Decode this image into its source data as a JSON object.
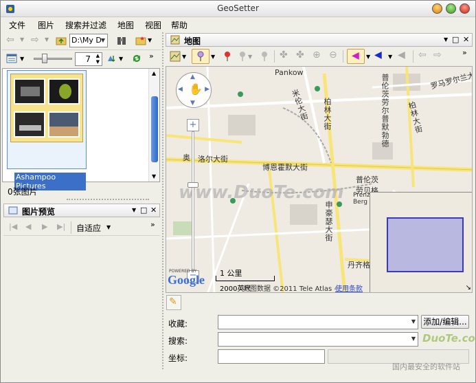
{
  "window": {
    "title": "GeoSetter"
  },
  "menu": [
    "文件",
    "图片",
    "搜索并过滤",
    "地图",
    "视图",
    "帮助"
  ],
  "toolbar": {
    "path_value": "D:\\My D",
    "zoom_value": "7"
  },
  "thumbnail": {
    "label": "Ashampoo Pictures"
  },
  "status": {
    "image_count": "0张图片"
  },
  "preview_panel": {
    "title": "图片预览",
    "fit_label": "自适应"
  },
  "map_panel": {
    "title": "地图"
  },
  "map": {
    "labels": {
      "pankow": "Pankow",
      "street_cn_1": "米伦大街",
      "street_cn_2": "柏林大街",
      "street_cn_3": "普伦茨劳尔普默勃德",
      "street_cn_4": "罗马罗尔兰大",
      "street_cn_5": "柏林大街",
      "street_cn_6": "奥",
      "street_cn_7": "洛尔大街",
      "street_cn_8": "博恩霍默大街",
      "street_cn_9": "普伦茨劳贝格",
      "street_cn_10": "申豪瑟大街",
      "street_cn_11": "丹齐格",
      "street_cn_12": "Prenzl Berg",
      "scale": "1 公里",
      "copyright": "2000英尺",
      "attribution": "地图数据 ©2011 Tele Atlas - ",
      "terms": "使用条款",
      "watermark": "www.DuoTe.com",
      "powered": "POWERED BY",
      "google": "Google"
    }
  },
  "form": {
    "favorites_label": "收藏:",
    "search_label": "搜索:",
    "coords_label": "坐标:",
    "add_edit_button": "添加/编辑...",
    "favorites_value": "",
    "search_value": "",
    "coords_value": ""
  },
  "watermark_site": {
    "line1": "DuoTe.com",
    "line2": "国内最安全的软件站"
  }
}
